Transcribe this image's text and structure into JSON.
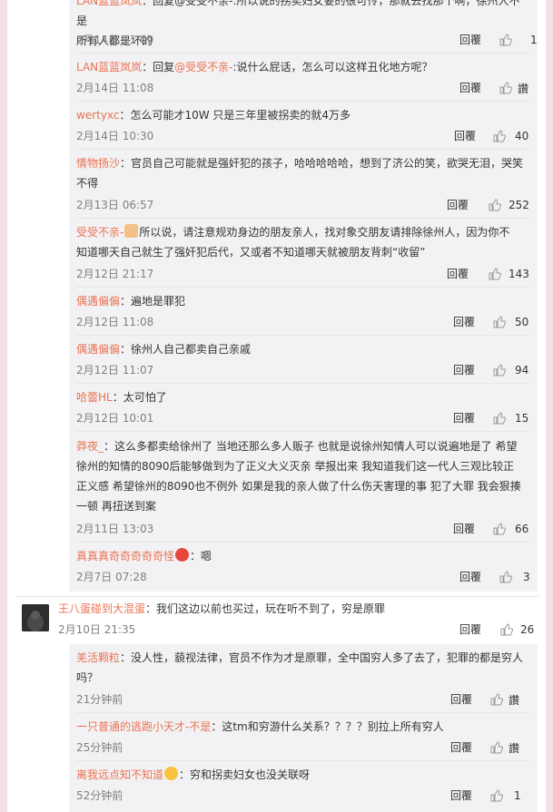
{
  "labels": {
    "reply": "回覆",
    "like_zh": "讚"
  },
  "comments": [
    {
      "user": "LAN蓝蓝岚岚",
      "mention": "",
      "text": "：回复@受受不亲-:所以说的拐卖妇女要的很可怜，那就去找那个啊，徐州人不是",
      "text2": "所有人都是坏的",
      "time": "2月14日 11:09",
      "likes": "1"
    },
    {
      "user": "LAN蓝蓝岚岚",
      "mention": "@受受不亲-",
      "text_pre": "：回复",
      "text": ":说什么屁话，怎么可以这样丑化地方呢？",
      "time": "2月14日 11:08",
      "likes": "讚"
    },
    {
      "user": "wertyxc",
      "text": "：怎么可能才10W 只是三年里被拐卖的就4万多",
      "time": "2月14日 10:30",
      "likes": "40"
    },
    {
      "user": "情物扬沙",
      "text": "：官员自己可能就是强奸犯的孩子，哈哈哈哈哈，想到了济公的笑，欲哭无泪，哭笑",
      "text2": "不得",
      "time": "2月13日 06:57",
      "likes": "252"
    },
    {
      "user": "受受不亲-",
      "text": "所以说，请注意规劝身边的朋友亲人，找对象交朋友请排除徐州人，因为你不",
      "text2": "知道哪天自己就生了强奸犯后代，又或者不知道哪天就被朋友背刺“收留”",
      "time": "2月12日 21:17",
      "likes": "143"
    },
    {
      "user": "偶遇偏偏",
      "text": "：遍地是罪犯",
      "time": "2月12日 11:08",
      "likes": "50"
    },
    {
      "user": "偶遇偏偏",
      "text": "：徐州人自己都卖自己亲戚",
      "time": "2月12日 11:07",
      "likes": "94"
    },
    {
      "user": "哈蕾HL",
      "text": "：太可怕了",
      "time": "2月12日 10:01",
      "likes": "15"
    },
    {
      "user": "莽夜_",
      "text": "：这么多都卖给徐州了 当地还那么多人贩子 也就是说徐州知情人可以说遍地是了 希望",
      "text2": "徐州的知情的8090后能够做到为了正义大义灭亲 举报出来 我知道我们这一代人三观比较正",
      "text3": "正义感 希望徐州的8090也不例外 如果是我的亲人做了什么伤天害理的事 犯了大罪 我会狠揍",
      "text4": "一顿 再扭送到案",
      "time": "2月11日 13:03",
      "likes": "66"
    },
    {
      "user": "真真真奇奇奇奇奇怪",
      "text": "：嗯",
      "time": "2月7日 07:28",
      "likes": "3"
    }
  ],
  "main_comment": {
    "user": "王八蛋碰到大混蛋",
    "text": "：我们这边以前也买过，玩在听不到了，穷是原罪",
    "time": "2月10日 21:35",
    "likes": "26"
  },
  "replies": [
    {
      "user": "羌活颗粒",
      "text": "：没人性，藐视法律，官员不作为才是原罪，全中国穷人多了去了，犯罪的都是穷人",
      "text2": "吗？",
      "time": "21分钟前",
      "likes": "讚"
    },
    {
      "user": "一只普通的逃跑小天才-不是",
      "text": "：这tm和穷游什么关系？？？？别拉上所有穷人",
      "time": "25分钟前",
      "likes": "讚"
    },
    {
      "user": "离我远点知不知道",
      "text": "：穷和拐卖妇女也没关联呀",
      "time": "52分钟前",
      "likes": "1"
    }
  ]
}
